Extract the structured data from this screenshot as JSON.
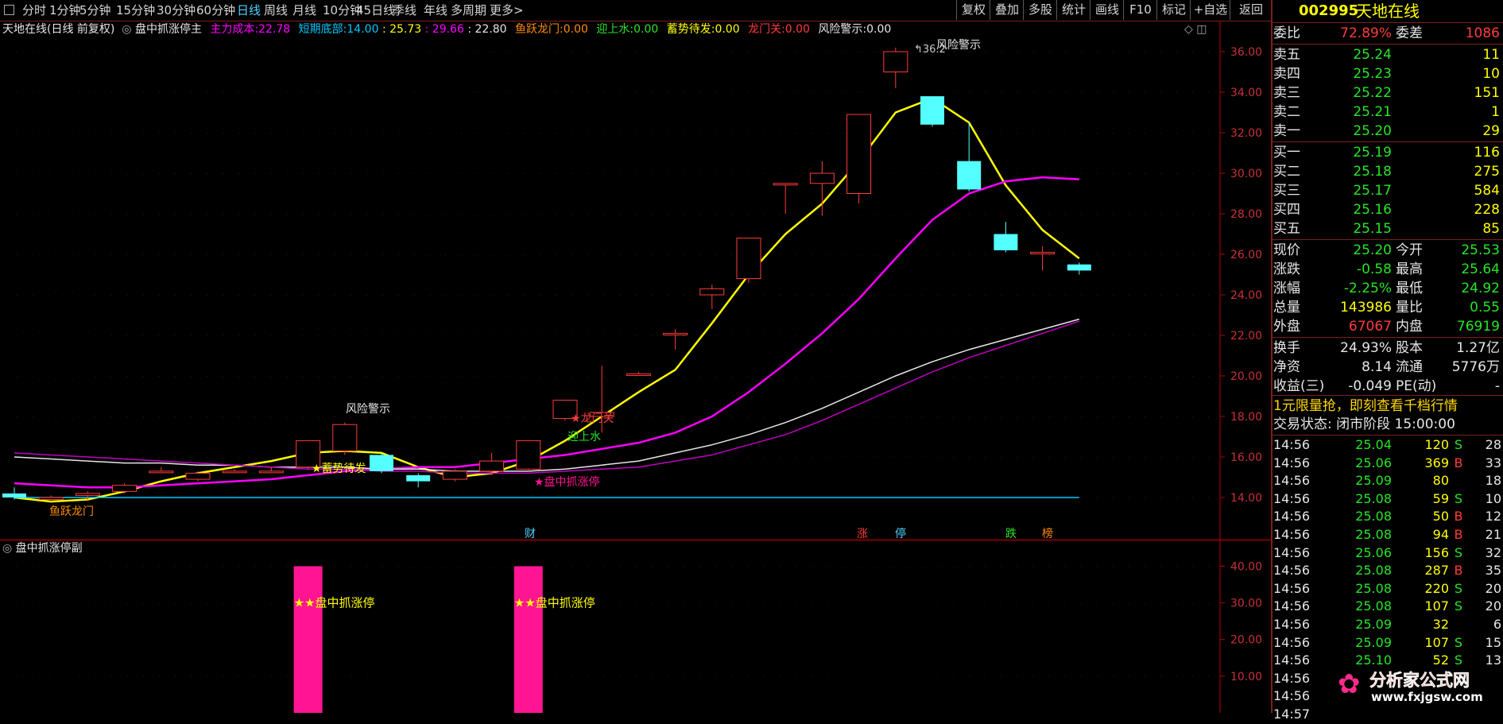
{
  "colors": {
    "up": "#ff3b3b",
    "down": "#54ffff",
    "yellow": "#ffff00",
    "magenta": "#ff00ff",
    "white": "#e6e6e6",
    "violet": "#c000c0",
    "cyan": "#00c8ff",
    "pink": "#ff1493",
    "green": "#27e527",
    "axis": "#b00000"
  },
  "toolbar": {
    "tabs": [
      "分时",
      "1分钟",
      "5分钟",
      "15分钟",
      "30分钟",
      "60分钟",
      "日线",
      "周线",
      "月线",
      "10分钟",
      "45日线",
      "季线",
      "年线",
      "多周期",
      "更多>"
    ],
    "active_tab": "日线",
    "right_buttons": [
      "复权",
      "叠加",
      "多股",
      "统计",
      "画线",
      "F10",
      "标记",
      "+自选",
      "返回"
    ]
  },
  "main_header": {
    "stock": "天地在线(日线 前复权)",
    "indicator": "盘中抓涨停主",
    "zhuli_label": "主力成本:",
    "zhuli_value": "22.78",
    "dqdb_label": "短期底部:",
    "dqdb_values": "14.00",
    "v1": ": 25.73",
    "v2": ": 29.66",
    "v3": ": 22.80",
    "yylm_label": "鱼跃龙门:",
    "yylm_value": "0.00",
    "ysh_label": "迎上水:",
    "ysh_value": "0.00",
    "xsdf_label": "蓄势待发:",
    "xsdf_value": "0.00",
    "lmg_label": "龙门关:",
    "lmg_value": "0.00",
    "fxjs_label": "风险警示:",
    "fxjs_value": "0.00"
  },
  "sub_header": {
    "indicator": "盘中抓涨停副"
  },
  "annotations": {
    "risk_top": "风险警示",
    "risk_left": "风险警示",
    "hi_price": "36.2",
    "xsdf": "★蓄势待发",
    "pzzt": "★盘中抓涨停",
    "lmg": "★龙门关",
    "ysh": "迎上水",
    "yylm": "鱼跃龙门",
    "bottom_marks": [
      "财",
      "涨",
      "停",
      "跌",
      "榜"
    ],
    "sub_signal": "★★盘中抓涨停"
  },
  "chart_data": [
    {
      "type": "candlestick",
      "title": "天地在线(日线 前复权)",
      "ylim": [
        13,
        37
      ],
      "y_ticks": [
        14,
        16,
        18,
        20,
        22,
        24,
        26,
        28,
        30,
        32,
        34,
        36
      ],
      "candles": [
        {
          "o": 14.2,
          "h": 14.5,
          "l": 13.9,
          "c": 14.0
        },
        {
          "o": 13.9,
          "h": 14.1,
          "l": 13.8,
          "c": 14.0
        },
        {
          "o": 14.1,
          "h": 14.3,
          "l": 13.9,
          "c": 14.2
        },
        {
          "o": 14.3,
          "h": 14.7,
          "l": 14.2,
          "c": 14.6
        },
        {
          "o": 15.3,
          "h": 15.5,
          "l": 15.2,
          "c": 15.3
        },
        {
          "o": 14.9,
          "h": 15.3,
          "l": 14.8,
          "c": 15.2
        },
        {
          "o": 15.3,
          "h": 15.4,
          "l": 15.2,
          "c": 15.3
        },
        {
          "o": 15.3,
          "h": 15.5,
          "l": 15.2,
          "c": 15.3
        },
        {
          "o": 15.5,
          "h": 16.8,
          "l": 15.4,
          "c": 16.8
        },
        {
          "o": 16.3,
          "h": 17.7,
          "l": 16.1,
          "c": 17.6
        },
        {
          "o": 16.1,
          "h": 16.2,
          "l": 15.2,
          "c": 15.3
        },
        {
          "o": 15.1,
          "h": 15.2,
          "l": 14.5,
          "c": 14.8
        },
        {
          "o": 14.9,
          "h": 15.4,
          "l": 14.8,
          "c": 15.3
        },
        {
          "o": 15.3,
          "h": 16.2,
          "l": 15.1,
          "c": 15.8
        },
        {
          "o": 15.4,
          "h": 16.8,
          "l": 15.3,
          "c": 16.8
        },
        {
          "o": 17.9,
          "h": 18.8,
          "l": 17.8,
          "c": 18.8
        },
        {
          "o": 18.0,
          "h": 20.5,
          "l": 17.2,
          "c": 18.2
        },
        {
          "o": 20.1,
          "h": 20.2,
          "l": 20.0,
          "c": 20.1
        },
        {
          "o": 22.1,
          "h": 22.3,
          "l": 21.3,
          "c": 22.1
        },
        {
          "o": 24.0,
          "h": 24.5,
          "l": 23.3,
          "c": 24.3
        },
        {
          "o": 24.8,
          "h": 26.8,
          "l": 24.6,
          "c": 26.8
        },
        {
          "o": 29.5,
          "h": 29.5,
          "l": 28.0,
          "c": 29.5
        },
        {
          "o": 29.5,
          "h": 30.6,
          "l": 27.9,
          "c": 30.0
        },
        {
          "o": 29.0,
          "h": 32.9,
          "l": 28.5,
          "c": 32.9
        },
        {
          "o": 35.0,
          "h": 36.2,
          "l": 34.2,
          "c": 36.0
        },
        {
          "o": 33.8,
          "h": 33.8,
          "l": 32.3,
          "c": 32.4
        },
        {
          "o": 30.6,
          "h": 32.5,
          "l": 29.1,
          "c": 29.2
        },
        {
          "o": 27.0,
          "h": 27.6,
          "l": 26.1,
          "c": 26.2
        },
        {
          "o": 26.1,
          "h": 26.4,
          "l": 25.2,
          "c": 26.1
        },
        {
          "o": 25.5,
          "h": 25.6,
          "l": 25.0,
          "c": 25.2
        }
      ],
      "series": [
        {
          "name": "主力成本",
          "color": "#ffff00",
          "values": [
            14.0,
            13.8,
            13.9,
            14.3,
            14.8,
            15.2,
            15.5,
            15.8,
            16.2,
            16.3,
            16.2,
            15.5,
            15.0,
            15.2,
            15.8,
            16.8,
            18.0,
            19.2,
            20.3,
            22.6,
            25.0,
            27.0,
            28.5,
            30.6,
            33.0,
            33.7,
            32.5,
            29.4,
            27.2,
            25.8
          ]
        },
        {
          "name": "",
          "color": "#ff00ff",
          "values": [
            14.7,
            14.6,
            14.5,
            14.5,
            14.6,
            14.7,
            14.8,
            14.9,
            15.1,
            15.3,
            15.4,
            15.5,
            15.5,
            15.7,
            15.9,
            16.1,
            16.4,
            16.7,
            17.2,
            18.0,
            19.2,
            20.6,
            22.1,
            23.8,
            25.8,
            27.7,
            29.0,
            29.6,
            29.8,
            29.7
          ]
        },
        {
          "name": "",
          "color": "#e6e6e6",
          "values": [
            16.0,
            15.9,
            15.8,
            15.7,
            15.7,
            15.6,
            15.6,
            15.5,
            15.5,
            15.5,
            15.4,
            15.4,
            15.3,
            15.3,
            15.3,
            15.4,
            15.6,
            15.8,
            16.2,
            16.6,
            17.1,
            17.7,
            18.4,
            19.2,
            20.0,
            20.7,
            21.3,
            21.8,
            22.3,
            22.8
          ]
        },
        {
          "name": "",
          "color": "#c000c0",
          "values": [
            16.2,
            16.1,
            16.0,
            15.9,
            15.8,
            15.7,
            15.6,
            15.5,
            15.4,
            15.4,
            15.3,
            15.3,
            15.2,
            15.2,
            15.2,
            15.3,
            15.4,
            15.5,
            15.8,
            16.1,
            16.6,
            17.1,
            17.8,
            18.6,
            19.4,
            20.2,
            20.9,
            21.5,
            22.1,
            22.7
          ]
        },
        {
          "name": "短期底部",
          "color": "#00c8ff",
          "values": [
            14.0,
            14.0,
            14.0,
            14.0,
            14.0,
            14.0,
            14.0,
            14.0,
            14.0,
            14.0,
            14.0,
            14.0,
            14.0,
            14.0,
            14.0,
            14.0,
            14.0,
            14.0,
            14.0,
            14.0,
            14.0,
            14.0,
            14.0,
            14.0,
            14.0,
            14.0,
            14.0,
            14.0,
            14.0,
            14.0
          ]
        }
      ]
    },
    {
      "type": "bar",
      "title": "盘中抓涨停副",
      "ylim": [
        0,
        44
      ],
      "y_ticks": [
        10,
        20,
        30,
        40
      ],
      "bars": [
        {
          "index": 8,
          "value": 40
        },
        {
          "index": 14,
          "value": 40
        }
      ]
    }
  ],
  "panel": {
    "code": "002995",
    "name": "天地在线",
    "weibi_label": "委比",
    "weibi": "72.89%",
    "weicha_label": "委差",
    "weicha": "1086",
    "asks": [
      {
        "label": "卖五",
        "price": "25.24",
        "vol": "11"
      },
      {
        "label": "卖四",
        "price": "25.23",
        "vol": "10"
      },
      {
        "label": "卖三",
        "price": "25.22",
        "vol": "151"
      },
      {
        "label": "卖二",
        "price": "25.21",
        "vol": "1"
      },
      {
        "label": "卖一",
        "price": "25.20",
        "vol": "29"
      }
    ],
    "bids": [
      {
        "label": "买一",
        "price": "25.19",
        "vol": "116"
      },
      {
        "label": "买二",
        "price": "25.18",
        "vol": "275"
      },
      {
        "label": "买三",
        "price": "25.17",
        "vol": "584"
      },
      {
        "label": "买四",
        "price": "25.16",
        "vol": "228"
      },
      {
        "label": "买五",
        "price": "25.15",
        "vol": "85"
      }
    ],
    "quote": [
      {
        "l1": "现价",
        "v1": "25.20",
        "c1": "#27e527",
        "l2": "今开",
        "v2": "25.53",
        "c2": "#27e527"
      },
      {
        "l1": "涨跌",
        "v1": "-0.58",
        "c1": "#27e527",
        "l2": "最高",
        "v2": "25.64",
        "c2": "#27e527"
      },
      {
        "l1": "涨幅",
        "v1": "-2.25%",
        "c1": "#27e527",
        "l2": "最低",
        "v2": "24.92",
        "c2": "#27e527"
      },
      {
        "l1": "总量",
        "v1": "143986",
        "c1": "#ffff00",
        "l2": "量比",
        "v2": "0.55",
        "c2": "#27e527"
      },
      {
        "l1": "外盘",
        "v1": "67067",
        "c1": "#ff3b3b",
        "l2": "内盘",
        "v2": "76919",
        "c2": "#27e527"
      }
    ],
    "fund": [
      {
        "l1": "换手",
        "v1": "24.93%",
        "l2": "股本",
        "v2": "1.27亿"
      },
      {
        "l1": "净资",
        "v1": "8.14",
        "l2": "流通",
        "v2": "5776万"
      },
      {
        "l1": "收益(三)",
        "v1": "-0.049",
        "l2": "PE(动)",
        "v2": "-"
      }
    ],
    "promo": "1元限量抢，即刻查看千档行情",
    "status": "交易状态: 闭市阶段 15:00:00",
    "ticks": [
      {
        "t": "14:56",
        "p": "25.04",
        "v": "120",
        "s": "S",
        "n": "28"
      },
      {
        "t": "14:56",
        "p": "25.06",
        "v": "369",
        "s": "B",
        "n": "33"
      },
      {
        "t": "14:56",
        "p": "25.09",
        "v": "80",
        "s": "",
        "n": "18"
      },
      {
        "t": "14:56",
        "p": "25.08",
        "v": "59",
        "s": "S",
        "n": "10"
      },
      {
        "t": "14:56",
        "p": "25.08",
        "v": "50",
        "s": "B",
        "n": "12"
      },
      {
        "t": "14:56",
        "p": "25.08",
        "v": "94",
        "s": "B",
        "n": "21"
      },
      {
        "t": "14:56",
        "p": "25.06",
        "v": "156",
        "s": "S",
        "n": "32"
      },
      {
        "t": "14:56",
        "p": "25.08",
        "v": "287",
        "s": "B",
        "n": "35"
      },
      {
        "t": "14:56",
        "p": "25.08",
        "v": "220",
        "s": "S",
        "n": "20"
      },
      {
        "t": "14:56",
        "p": "25.08",
        "v": "107",
        "s": "S",
        "n": "20"
      },
      {
        "t": "14:56",
        "p": "25.09",
        "v": "32",
        "s": "",
        "n": "6"
      },
      {
        "t": "14:56",
        "p": "25.09",
        "v": "107",
        "s": "S",
        "n": "15"
      },
      {
        "t": "14:56",
        "p": "25.10",
        "v": "52",
        "s": "S",
        "n": "13"
      },
      {
        "t": "14:56",
        "p": "",
        "v": "",
        "s": "",
        "n": ""
      },
      {
        "t": "14:56",
        "p": "",
        "v": "",
        "s": "",
        "n": ""
      },
      {
        "t": "14:57",
        "p": "",
        "v": "",
        "s": "",
        "n": ""
      }
    ],
    "watermark": "分析家公式网",
    "watermark_url": "www.fxjgsw.com"
  }
}
